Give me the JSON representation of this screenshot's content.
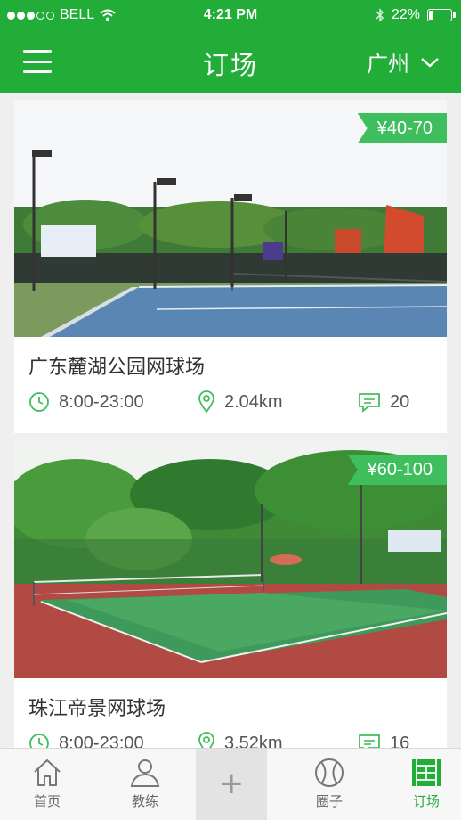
{
  "status_bar": {
    "carrier": "BELL",
    "time": "4:21 PM",
    "battery": "22%",
    "battery_level": 0.22
  },
  "header": {
    "title": "订场",
    "city": "广州"
  },
  "venues": [
    {
      "name": "广东麓湖公园网球场",
      "price": "¥40-70",
      "hours": "8:00-23:00",
      "distance": "2.04km",
      "comments": "20"
    },
    {
      "name": "珠江帝景网球场",
      "price": "¥60-100",
      "hours": "8:00-23:00",
      "distance": "3.52km",
      "comments": "16"
    }
  ],
  "tabs": [
    {
      "label": "首页",
      "icon": "home-icon"
    },
    {
      "label": "教练",
      "icon": "user-icon"
    },
    {
      "label": "",
      "icon": "plus-icon"
    },
    {
      "label": "圈子",
      "icon": "tennis-ball-icon"
    },
    {
      "label": "订场",
      "icon": "court-icon",
      "active": true
    }
  ],
  "colors": {
    "brand": "#22ac38",
    "price_tag": "#3fbe5d"
  }
}
